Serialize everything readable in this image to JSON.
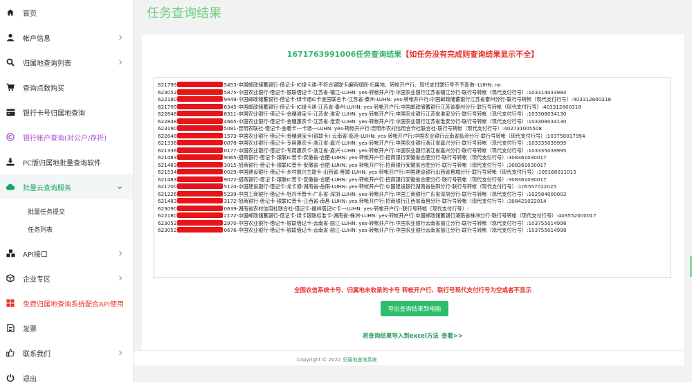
{
  "sidebar": {
    "items": [
      {
        "label": "首页",
        "icon": "home-icon"
      },
      {
        "label": "帐户信息",
        "icon": "user-icon"
      },
      {
        "label": "归属地查询列表",
        "icon": "search-icon"
      },
      {
        "label": "查询点数购买",
        "icon": "cart-icon"
      },
      {
        "label": "银行卡号归属地查询",
        "icon": "credit-card-icon"
      },
      {
        "label": "银行帐户查询(对公户/存折)",
        "icon": "copyright-icon"
      },
      {
        "label": "PC版归属地批量查询软件",
        "icon": "download-icon"
      },
      {
        "label": "批量云查询服务",
        "icon": "cloud-icon"
      },
      {
        "label": "API接口",
        "icon": "cubes-icon"
      },
      {
        "label": "企业专区",
        "icon": "cube-icon"
      },
      {
        "label": "免费归属地查询系统配合API使用",
        "icon": "windows-icon"
      },
      {
        "label": "发票",
        "icon": "invoice-icon"
      },
      {
        "label": "联系我们",
        "icon": "thumbs-up-icon"
      },
      {
        "label": "退出",
        "icon": "power-icon"
      }
    ],
    "sub_items": [
      {
        "label": "批量任务提交"
      },
      {
        "label": "任务列表"
      }
    ]
  },
  "page": {
    "title": "任务查询结果"
  },
  "heading": {
    "task_id_text": "1671763991006任务查询结果",
    "warning_text": "【如任务没有完成则查询结果显示不全】"
  },
  "results": [
    {
      "prefix": "621799",
      "rest": "5453-中国邮政储蓄银行-借记卡-IC绿卡通-不符合银联卡编码规则-归属地、转帐开户行、现代支付联行号不予查询--LUHN: no"
    },
    {
      "prefix": "623052",
      "rest": "5875-中国农业银行-借记卡-银联借记卡-江苏省-镇江-LUHN: yes-转帐开户行:中国农业银行江苏省镇江分行-联行号转帐（现代支付行号）:103314033984"
    },
    {
      "prefix": "622180",
      "rest": "9449-中国邮政储蓄银行-借记卡-绿卡通IC卡金国联名卡-江苏省-泰州-LUHN: yes-转帐开户行:中国邮政储蓄银行江苏省泰州分行-联行号转帐（现代支付行号）:403312800318"
    },
    {
      "prefix": "621799",
      "rest": "8345-中国邮政储蓄银行-借记卡-IC绿卡通-江苏省-泰州-LUHN: yes-转帐开户行:中国邮政储蓄银行江苏省泰州分行-联行号转帐（现代支付行号）:403312800318"
    },
    {
      "prefix": "622848",
      "rest": "8311-中国农业银行-借记卡-金穗通宝卡-江苏省-淮安-LUHN: yes-转帐开户行:中国农业银行江苏省淮安分行-联行号转帐（现代支付行号）:103308034130"
    },
    {
      "prefix": "622848",
      "rest": "4665-中国农业银行-借记卡-金穗惠农卡-江苏省-淮安-LUHN: yes-转帐开户行:中国农业银行江苏省淮安分行-联行号转帐（现代支付行号）:103308034130"
    },
    {
      "prefix": "623190",
      "rest": "5081-昆明农联社-借记卡-金碧卡---卡通---LUHN: yes-转帐开户行:昆明市农村信用合作社联合社-联行号转帐（现代支付行号）:402731005508"
    },
    {
      "prefix": "622848",
      "rest": "1573-中国农业银行-借记卡-金穗通宝卡(银联卡)-云南省-临沧-LUHN: yes-转帐开户行:中国农业银行云南省临沧分行-联行号转帐（现代支付行号）:103758017994"
    },
    {
      "prefix": "621336",
      "rest": "0078-中国农业银行-借记卡-专用惠农卡-浙江省-嘉兴-LUHN: yes-转帐开户行:中国农业银行浙江省嘉兴分行-联行号转帐（现代支付行号）:103335039995"
    },
    {
      "prefix": "621336",
      "rest": "0177-中国农业银行-借记卡-专用惠农卡-浙江省-嘉兴-LUHN: yes-转帐开户行:中国农业银行浙江省嘉兴分行-联行号转帐（现代支付行号）:103335039995"
    },
    {
      "prefix": "621483",
      "rest": "9065-招商银行-借记卡-银联IC普卡-安徽省-合肥-LUHN: yes-转帐开户行:招商银行安徽省合肥分行-联行号转帐（现代支付行号）:308361030017"
    },
    {
      "prefix": "621483",
      "rest": "3015-招商银行-借记卡-银联IC普卡-安徽省-合肥-LUHN: yes-转帐开户行:招商银行安徽省合肥分行-联行号转帐（现代支付行号）:308361030017"
    },
    {
      "prefix": "621534",
      "rest": "0029-中国建设银行-借记卡-乡村振兴主题卡-山西省-晋城-LUHN: yes-转帐开户行:中国建设银行山西省晋城分行-联行号转帐（现代支付行号）:105168011015"
    },
    {
      "prefix": "621483",
      "rest": "9072-招商银行-借记卡-银联IC普卡-安徽省-合肥-LUHN: yes-转帐开户行:招商银行安徽省合肥分行-联行号转帐（现代支付行号）:308361030017"
    },
    {
      "prefix": "621700",
      "rest": "5124-中国建设银行-借记卡-龙卡通-湖南省-岳阳-LUHN: yes-转帐开户行:中国建设银行湖南省岳阳分行-联行号转帐（现代支付行号）:105557012025"
    },
    {
      "prefix": "621226",
      "rest": "5239-中国工商银行-借记卡-牡丹卡普卡-广东省-深圳-LUHN: yes-转帐开户行:中国工商银行广东省深圳分行-联行号转帐（现代支付行号）:102584000002"
    },
    {
      "prefix": "621483",
      "rest": "3172-招商银行-借记卡-银联IC普卡-江西省-南昌-LUHN: yes-转帐开户行:招商银行江西省南昌分行-联行号转帐（现代支付行号）:308421022014"
    },
    {
      "prefix": "623090",
      "rest": "0639-湖南省农村信用社联合社-借记卡-福祥借记IC卡---LUHN: yes-转帐开户行:-联行号转帐（现代支付行号）:"
    },
    {
      "prefix": "622180",
      "rest": "2172-中国邮政储蓄银行-借记卡-绿卡银联标准卡-湖南省-株洲-LUHN: yes-转帐开户行:中国邮政储蓄银行湖南省株洲分行-联行号转帐（现代支付行号）:403552000017"
    },
    {
      "prefix": "623052",
      "rest": "2970-中国农业银行-借记卡-银联借记卡-云南省-丽江-LUHN: yes-转帐开户行:中国农业银行云南省丽江分行-联行号转帐（现代支付行号）:103755014998"
    },
    {
      "prefix": "623052",
      "rest": "0676-中国农业银行-借记卡-银联借记卡-云南省-丽江-LUHN: yes-转帐开户行:中国农业银行云南省丽江分行-联行号转帐（现代支付行号）:103755014998"
    }
  ],
  "notes": {
    "empty_notice": "全国农信系统卡号、归属地未收录的卡号 转帐开户行、联行号现代支付行号为空或者不显示",
    "export_button": "导出查询结果到电脑",
    "excel_text": "将查询结果导入到excel方法",
    "excel_link": "查看>>"
  },
  "footer": {
    "copyright": "Copyright © 2022",
    "site_link": "归属地查询系统"
  },
  "colors": {
    "accent_green": "#2ebd6b",
    "title_green": "#6ccf7f",
    "warning_red": "#e8332e",
    "purple": "#a94bd1"
  }
}
